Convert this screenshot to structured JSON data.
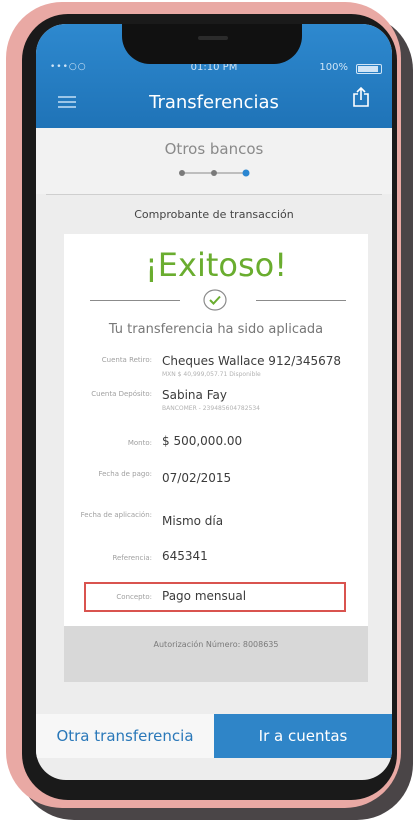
{
  "status_bar": {
    "signal": "•••○○",
    "time": "01:10 PM",
    "battery": "100%"
  },
  "header": {
    "title": "Transferencias"
  },
  "step": {
    "title": "Otros bancos",
    "current": 3,
    "total": 3
  },
  "receipt": {
    "label": "Comprobante de transacción",
    "success": "¡Exitoso!",
    "message": "Tu transferencia ha sido aplicada",
    "rows": [
      {
        "label": "Cuenta Retiro:",
        "value": "Cheques Wallace 912/345678",
        "sub": "MXN $ 40,999,057.71 Disponible"
      },
      {
        "label": "Cuenta Depósito:",
        "value": "Sabina Fay",
        "sub": "BANCOMER - 239485604782534"
      },
      {
        "label": "Monto:",
        "value": "$ 500,000.00"
      },
      {
        "label": "Fecha de pago:",
        "value": "07/02/2015"
      },
      {
        "label": "Fecha de aplicación:",
        "value": "Mismo día"
      },
      {
        "label": "Referencia:",
        "value": "645341"
      },
      {
        "label": "Concepto:",
        "value": "Pago mensual"
      }
    ],
    "authorization": "Autorización Número: 8008635"
  },
  "buttons": {
    "other_transfer": "Otra transferencia",
    "go_accounts": "Ir a cuentas"
  },
  "colors": {
    "header_blue": "#2377bb",
    "success_green": "#6aad2f",
    "highlight_red": "#d9534f",
    "frame_pink": "#e9a9a4"
  }
}
